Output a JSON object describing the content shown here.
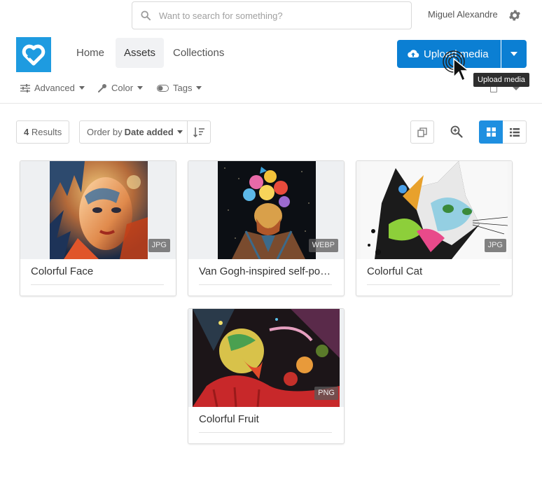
{
  "search": {
    "placeholder": "Want to search for something?"
  },
  "user": {
    "name": "Miguel Alexandre"
  },
  "nav": {
    "tabs": [
      {
        "label": "Home"
      },
      {
        "label": "Assets"
      },
      {
        "label": "Collections"
      }
    ],
    "active_tab": "Assets"
  },
  "upload": {
    "label": "Upload media",
    "tooltip": "Upload media"
  },
  "filters": [
    {
      "label": "Advanced",
      "icon": "sliders-icon"
    },
    {
      "label": "Color",
      "icon": "eyedropper-icon"
    },
    {
      "label": "Tags",
      "icon": "toggle-icon"
    }
  ],
  "toolbar": {
    "results_count": "4",
    "results_label": "Results",
    "order_prefix": "Order by",
    "order_value": "Date added",
    "view_mode": "grid"
  },
  "assets": [
    {
      "title": "Colorful Face",
      "format": "JPG"
    },
    {
      "title": "Van Gogh-inspired self-portrait",
      "format": "WEBP"
    },
    {
      "title": "Colorful Cat",
      "format": "JPG"
    },
    {
      "title": "Colorful Fruit",
      "format": "PNG"
    }
  ],
  "colors": {
    "primary": "#0b7fd3",
    "logo": "#1e9be0",
    "active_view": "#1e8fe0"
  }
}
